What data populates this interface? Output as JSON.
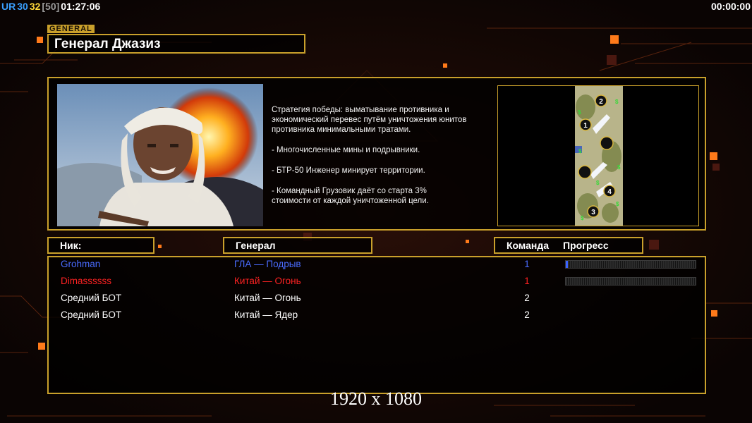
{
  "hud": {
    "ur_label": "UR",
    "fps": "30",
    "fps2": "32",
    "cap": "[50]",
    "clock": "01:27:06",
    "game_timer": "00:00:00",
    "colors": {
      "ur": "#3aa0ff",
      "fps": "#ffd83a",
      "cap": "#9a9a9a"
    }
  },
  "general": {
    "tag": "GENERAL",
    "title": "Генерал Джазиз",
    "description": [
      "Стратегия победы: выматывание противника и\n экономический перевес путём уничтожения юнитов\n противника минимальными тратами.",
      "- Многочисленные мины и подрывники.",
      "- БТР-50 Инженер минирует территории.",
      "- Командный Грузовик даёт со старта 3%\n стоимости от каждой уничтоженной цели."
    ],
    "map_slots": [
      "2",
      "1",
      "4",
      "3"
    ]
  },
  "headers": {
    "nick": "Ник:",
    "general": "Генерал",
    "team": "Команда",
    "progress": "Прогресс"
  },
  "players": [
    {
      "nick": "Grohman",
      "general": "ГЛА — Подрыв",
      "team": "1",
      "color": "#4a6cff",
      "progress": 0.01,
      "show_progress": true
    },
    {
      "nick": "Dimassssss",
      "general": "Китай — Огонь",
      "team": "1",
      "color": "#ff2222",
      "progress": 0,
      "show_progress": true
    },
    {
      "nick": "Средний БОТ",
      "general": "Китай — Огонь",
      "team": "2",
      "color": "#ffffff",
      "progress": 0,
      "show_progress": false
    },
    {
      "nick": "Средний БОТ",
      "general": "Китай — Ядер",
      "team": "2",
      "color": "#ffffff",
      "progress": 0,
      "show_progress": false
    }
  ],
  "resolution_note": "1920 x 1080",
  "accent_color": "#c9a02b"
}
